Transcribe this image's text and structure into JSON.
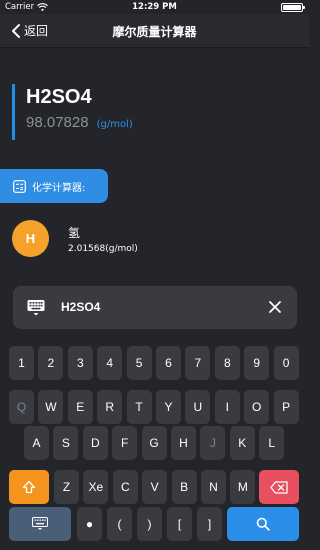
{
  "status_bar": {
    "carrier": "Carrier",
    "time": "12:29 PM"
  },
  "nav": {
    "back_label": "返回",
    "title": "摩尔质量计算器"
  },
  "result": {
    "formula": "H2SO4",
    "molar_mass": "98.07828",
    "unit": "(g/mol)"
  },
  "calculator_tab": {
    "label": "化学计算器:"
  },
  "element": {
    "symbol": "H",
    "name": "氢",
    "mass": "2.01568(g/mol)"
  },
  "input": {
    "value": "H2SO4"
  },
  "keyboard": {
    "row1": [
      "1",
      "2",
      "3",
      "4",
      "5",
      "6",
      "7",
      "8",
      "9",
      "0"
    ],
    "row2": [
      "Q",
      "W",
      "E",
      "R",
      "T",
      "Y",
      "U",
      "I",
      "O",
      "P"
    ],
    "row3": [
      "A",
      "S",
      "D",
      "F",
      "G",
      "H",
      "J",
      "K",
      "L"
    ],
    "row4": [
      "Z",
      "Xe",
      "C",
      "V",
      "B",
      "N",
      "M"
    ],
    "row5": [
      "●",
      "(",
      ")",
      "[",
      "]"
    ],
    "disabled_keys": [
      "Q",
      "J"
    ]
  },
  "colors": {
    "accent": "#2b8ee8",
    "shift": "#f5931f",
    "delete": "#e8505f",
    "element_badge": "#f6a22a"
  }
}
